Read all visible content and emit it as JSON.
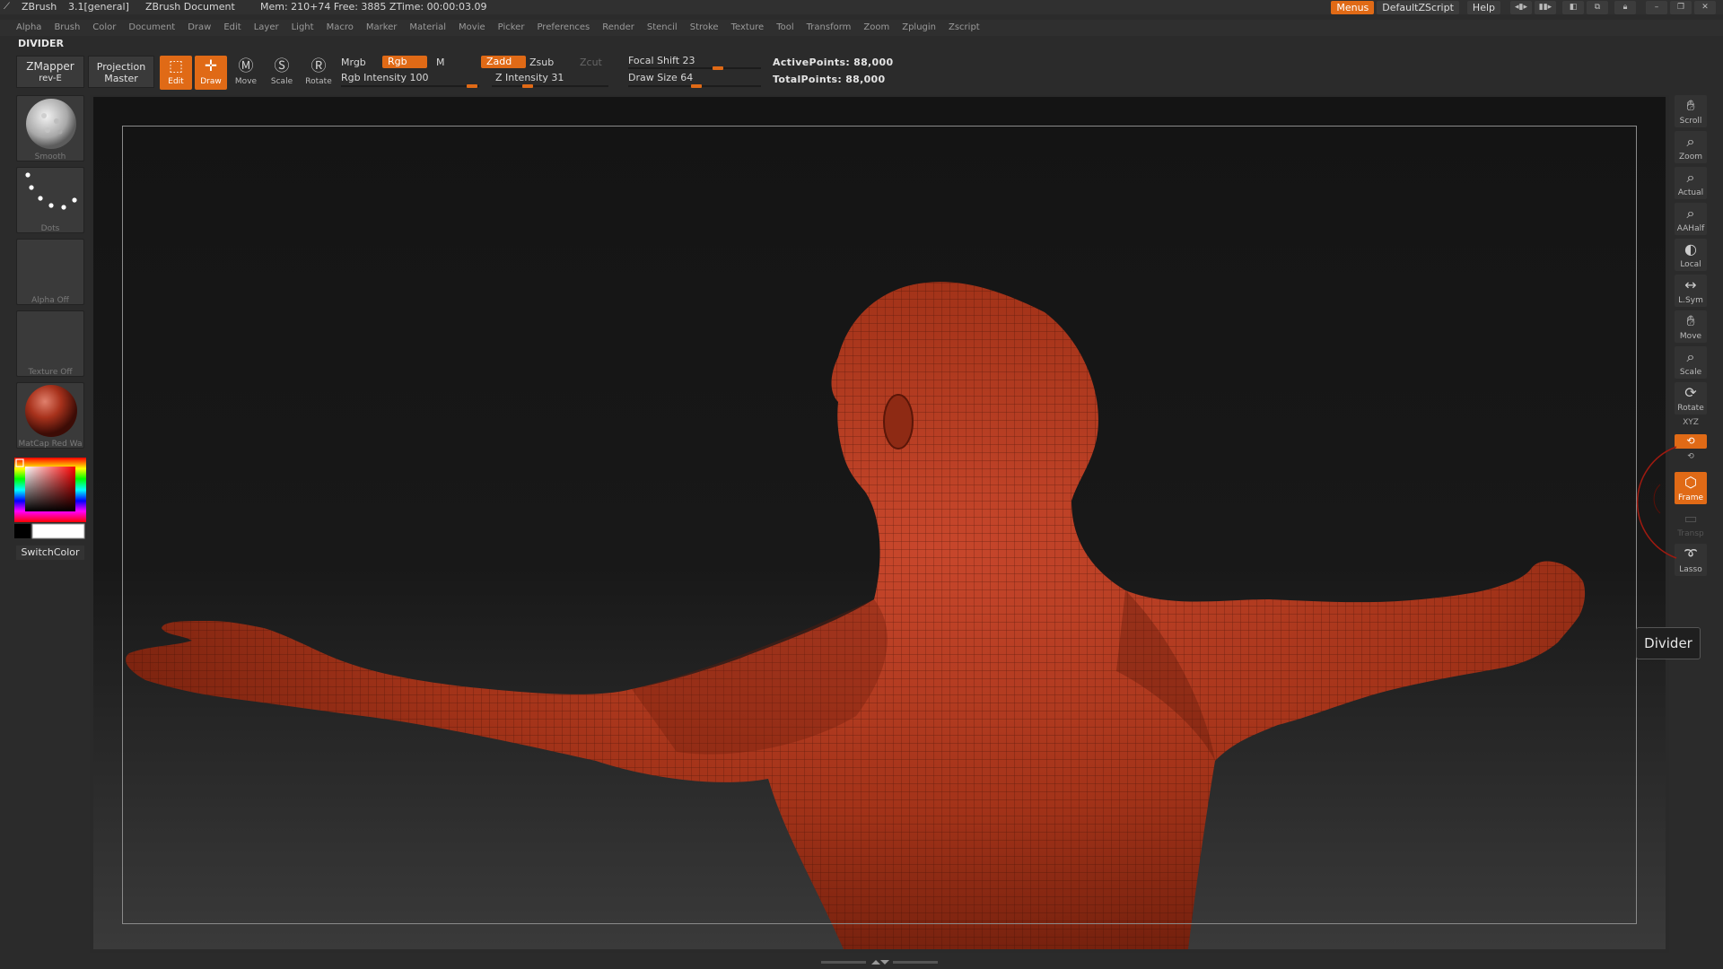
{
  "titlebar": {
    "app": "ZBrush",
    "version": "3.1[general]",
    "document": "ZBrush Document",
    "mem": "Mem: 210+74 Free: 3885 ZTime: 00:00:03.09",
    "menus_btn": "Menus",
    "script_btn": "DefaultZScript",
    "help_btn": "Help"
  },
  "menubar": [
    "Alpha",
    "Brush",
    "Color",
    "Document",
    "Draw",
    "Edit",
    "Layer",
    "Light",
    "Macro",
    "Marker",
    "Material",
    "Movie",
    "Picker",
    "Preferences",
    "Render",
    "Stencil",
    "Stroke",
    "Texture",
    "Tool",
    "Transform",
    "Zoom",
    "Zplugin",
    "Zscript"
  ],
  "palette_title": "DIVIDER",
  "shelf": {
    "zmapper": "ZMapper",
    "zmapper_sub": "rev-E",
    "projection": "Projection",
    "projection_sub": "Master",
    "edit": "Edit",
    "draw": "Draw",
    "move": "Move",
    "scale": "Scale",
    "rotate": "Rotate",
    "mrgb": "Mrgb",
    "rgb": "Rgb",
    "m": "M",
    "rgb_intensity": "Rgb Intensity 100",
    "zadd": "Zadd",
    "zsub": "Zsub",
    "zcut": "Zcut",
    "z_intensity": "Z Intensity 31",
    "focal_shift": "Focal Shift 23",
    "draw_size": "Draw Size 64",
    "active_points": "ActivePoints: 88,000",
    "total_points": "TotalPoints: 88,000",
    "rgb_intensity_value": 100,
    "z_intensity_value": 31,
    "focal_shift_value": 23,
    "draw_size_value": 64
  },
  "left_tray": {
    "smooth": "Smooth",
    "dots": "Dots",
    "alpha": "Alpha Off",
    "texture": "Texture Off",
    "material": "MatCap Red Wa",
    "switch_color": "SwitchColor"
  },
  "right_tray": {
    "scroll": "Scroll",
    "zoom": "Zoom",
    "actual": "Actual",
    "aahalf": "AAHalf",
    "local": "Local",
    "lsym": "L.Sym",
    "move": "Move",
    "scale": "Scale",
    "rotate": "Rotate",
    "xyz": "XYZ",
    "frame": "Frame",
    "transp": "Transp",
    "lasso": "Lasso"
  },
  "tooltip": "Divider",
  "colors": {
    "accent": "#e06a16",
    "skin": "#a8321c"
  }
}
